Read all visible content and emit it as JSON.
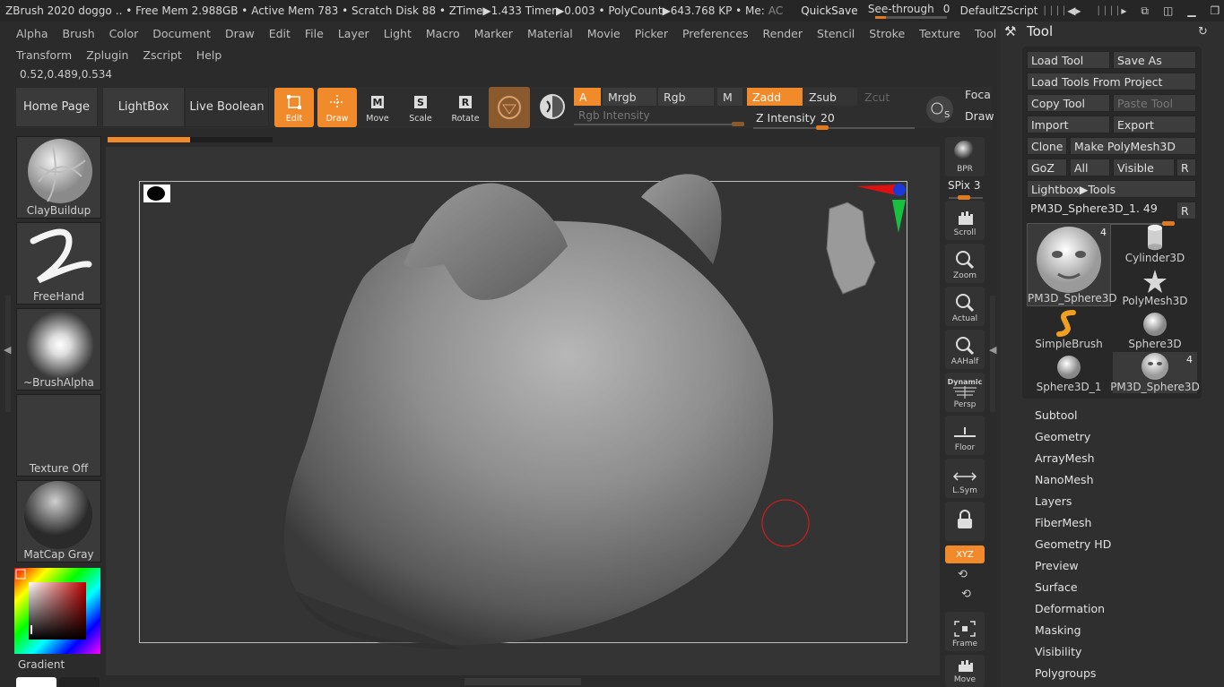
{
  "titlebar": {
    "app": "ZBrush 2020",
    "doc": "doggo",
    "stats": ".. • Free Mem 2.988GB • Active Mem 783 • Scratch Disk 88 • ZTime▶1.433 Timer▶0.003 • PolyCount▶643.768 KP • Me:",
    "ac": "AC",
    "quicksave": "QuickSave",
    "seethrough_label": "See-through",
    "seethrough_value": "0",
    "script": "DefaultZScript"
  },
  "menu_row1": [
    "Alpha",
    "Brush",
    "Color",
    "Document",
    "Draw",
    "Edit",
    "File",
    "Layer",
    "Light",
    "Macro",
    "Marker",
    "Material",
    "Movie",
    "Picker",
    "Preferences",
    "Render",
    "Stencil",
    "Stroke",
    "Texture",
    "Tool"
  ],
  "menu_row2": [
    "Transform",
    "Zplugin",
    "Zscript",
    "Help"
  ],
  "coords": "0.52,0.489,0.534",
  "shelf": {
    "home": "Home Page",
    "lightbox": "LightBox",
    "live_boolean": "Live Boolean",
    "edit": "Edit",
    "draw": "Draw",
    "move": "Move",
    "scale": "Scale",
    "rotate": "Rotate",
    "a": "A",
    "mrgb": "Mrgb",
    "rgb": "Rgb",
    "m": "M",
    "zadd": "Zadd",
    "zsub": "Zsub",
    "zcut": "Zcut",
    "rgb_intensity": "Rgb Intensity",
    "z_intensity_label": "Z Intensity",
    "z_intensity_value": "20",
    "focal": "Foca",
    "draw2": "Draw"
  },
  "left_panel": {
    "brush": "ClayBuildup",
    "stroke": "FreeHand",
    "alpha": "~BrushAlpha",
    "texture": "Texture Off",
    "material": "MatCap Gray",
    "gradient": "Gradient"
  },
  "right_strip": {
    "bpr": "BPR",
    "spix": "SPix 3",
    "scroll": "Scroll",
    "zoom": "Zoom",
    "actual": "Actual",
    "aahalf": "AAHalf",
    "dynamic": "Dynamic",
    "persp": "Persp",
    "floor": "Floor",
    "lsym": "L.Sym",
    "xyz": "XYZ",
    "frame": "Frame",
    "move": "Move"
  },
  "tool_palette": {
    "title": "Tool",
    "load_tool": "Load Tool",
    "save_as": "Save As",
    "load_project": "Load Tools From Project",
    "copy_tool": "Copy Tool",
    "paste_tool": "Paste Tool",
    "import": "Import",
    "export": "Export",
    "clone": "Clone",
    "make_polymesh": "Make PolyMesh3D",
    "goz": "GoZ",
    "all": "All",
    "visible": "Visible",
    "r": "R",
    "lightbox_tools": "Lightbox▶Tools",
    "current_tool": "PM3D_Sphere3D_1. 49",
    "thumbs": [
      {
        "label": "PM3D_Sphere3D",
        "count": "4"
      },
      {
        "label": "Cylinder3D",
        "count": ""
      },
      {
        "label": "PolyMesh3D",
        "count": ""
      },
      {
        "label": "SimpleBrush",
        "count": ""
      },
      {
        "label": "Sphere3D",
        "count": ""
      },
      {
        "label": "Sphere3D_1",
        "count": ""
      },
      {
        "label": "PM3D_Sphere3D",
        "count": "4"
      }
    ],
    "subpalettes": [
      "Subtool",
      "Geometry",
      "ArrayMesh",
      "NanoMesh",
      "Layers",
      "FiberMesh",
      "Geometry HD",
      "Preview",
      "Surface",
      "Deformation",
      "Masking",
      "Visibility",
      "Polygroups"
    ]
  },
  "colors": {
    "accent": "#f08a2a",
    "panel": "#2f2f2f",
    "canvas": "#343434"
  }
}
